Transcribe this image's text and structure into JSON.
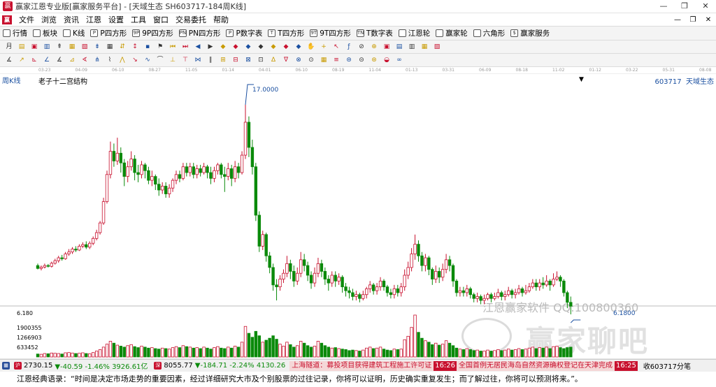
{
  "window": {
    "title": "赢家江恩专业版[赢家服务平台] - [天域生态 SH603717-184周K线]",
    "buttons": [
      "—",
      "❐",
      "✕"
    ]
  },
  "menu": {
    "items": [
      "文件",
      "浏览",
      "资讯",
      "江恩",
      "设置",
      "工具",
      "窗口",
      "交易委托",
      "帮助"
    ],
    "right": [
      "—",
      "❐",
      "✕"
    ]
  },
  "toolbar1": [
    {
      "label": "行情",
      "icon": "grid-icon"
    },
    {
      "label": "板块",
      "icon": "blocks-icon"
    },
    {
      "label": "K线",
      "icon": "candles-icon"
    },
    {
      "label": "P四方形",
      "icon": "P"
    },
    {
      "label": "9P四方形",
      "icon": "9P"
    },
    {
      "label": "PN四方形",
      "icon": "PN"
    },
    {
      "label": "P数字表",
      "icon": "P"
    },
    {
      "label": "T四方形",
      "icon": "T"
    },
    {
      "label": "9T四方形",
      "icon": "9T"
    },
    {
      "label": "T数字表",
      "icon": "TN"
    },
    {
      "label": "江恩轮",
      "icon": "wheel-icon"
    },
    {
      "label": "赢家轮",
      "icon": "wheel-icon"
    },
    {
      "label": "六角形",
      "icon": "hexagon-icon"
    },
    {
      "label": "赢家服务",
      "icon": "$"
    }
  ],
  "toolbar2": [
    "月",
    "▤",
    "▣",
    "▥",
    "⇞",
    "▦",
    "▧",
    "⇟",
    "▦",
    "⇵",
    "↕",
    "▪",
    "⚑",
    "⏮",
    "⏭",
    "◀",
    "▶",
    "◆",
    "◆",
    "◆",
    "◆",
    "◆",
    "◆",
    "◆",
    "✋",
    "+",
    "↖",
    "ƒ",
    "⊘",
    "⊕",
    "▣",
    "▤",
    "▥",
    "▦",
    "▧"
  ],
  "toolbar3": [
    "∡",
    "↗",
    "⊾",
    "∠",
    "∡",
    "⊿",
    "∢",
    "⋔",
    "⌇",
    "⋀",
    "↘",
    "∿",
    "⌒",
    "⊥",
    "⊤",
    "⋈",
    "∥",
    "⊞",
    "⊟",
    "⊠",
    "⊡",
    "∆",
    "∇",
    "⊗",
    "⊙",
    "▦",
    "≡",
    "⊜",
    "⊝",
    "⊛",
    "◒",
    "∞"
  ],
  "ruler": [
    "03-23",
    "04-09",
    "06-10",
    "08-27",
    "11-05",
    "01-14",
    "04-01",
    "06-10",
    "08-19",
    "11-04",
    "01-13",
    "03-31",
    "06-09",
    "08-18",
    "11-02",
    "01-12",
    "03-22",
    "05-31",
    "08-08"
  ],
  "chart_info": {
    "period": "周K线",
    "indicator": "老子十二宫结构",
    "dropdown_glyph": "▼",
    "code": "603717",
    "name": "天域生态"
  },
  "chart_data": {
    "type": "candlestick",
    "ylim": [
      6.18,
      17.0
    ],
    "yticks": [
      "6.180",
      "1900355",
      "1266903",
      "633452"
    ],
    "annotations": {
      "high": "17.0000",
      "low": "6.1800"
    },
    "up_color": "#c8102e",
    "down_color": "#0a8a0a",
    "ohlc": [
      [
        8.7,
        8.55,
        8.8,
        8.5
      ],
      [
        8.55,
        8.62,
        8.7,
        8.45
      ],
      [
        8.62,
        8.7,
        8.8,
        8.55
      ],
      [
        8.7,
        8.66,
        8.78,
        8.6
      ],
      [
        8.66,
        8.82,
        8.9,
        8.6
      ],
      [
        8.82,
        8.95,
        9.05,
        8.75
      ],
      [
        8.95,
        9.1,
        9.2,
        8.85
      ],
      [
        9.1,
        9.05,
        9.25,
        8.95
      ],
      [
        9.05,
        9.3,
        9.4,
        9.0
      ],
      [
        9.3,
        9.4,
        9.55,
        9.2
      ],
      [
        9.4,
        9.55,
        9.65,
        9.3
      ],
      [
        9.55,
        9.5,
        9.7,
        9.4
      ],
      [
        9.5,
        9.7,
        9.8,
        9.45
      ],
      [
        9.7,
        9.78,
        9.9,
        9.6
      ],
      [
        9.78,
        9.65,
        9.95,
        9.55
      ],
      [
        9.65,
        9.85,
        9.95,
        9.55
      ],
      [
        9.85,
        10.1,
        10.2,
        9.75
      ],
      [
        10.1,
        10.4,
        10.55,
        10.0
      ],
      [
        10.4,
        10.9,
        11.0,
        10.3
      ],
      [
        10.9,
        12.0,
        12.2,
        10.8
      ],
      [
        12.0,
        13.4,
        13.6,
        11.9
      ],
      [
        13.4,
        14.6,
        15.1,
        13.2
      ],
      [
        14.6,
        14.1,
        15.0,
        13.8
      ],
      [
        14.1,
        14.5,
        15.3,
        13.9
      ],
      [
        14.5,
        14.0,
        14.8,
        13.5
      ],
      [
        14.0,
        13.3,
        14.2,
        12.8
      ],
      [
        13.3,
        13.8,
        14.1,
        13.0
      ],
      [
        13.8,
        14.2,
        14.6,
        13.6
      ],
      [
        14.2,
        13.5,
        14.4,
        13.1
      ],
      [
        13.5,
        13.4,
        13.9,
        13.0
      ],
      [
        13.4,
        13.9,
        14.1,
        13.2
      ],
      [
        13.9,
        13.6,
        14.0,
        13.2
      ],
      [
        13.6,
        13.1,
        13.8,
        12.9
      ],
      [
        13.1,
        13.3,
        13.6,
        12.8
      ],
      [
        13.3,
        12.9,
        13.4,
        12.6
      ],
      [
        12.9,
        12.6,
        13.2,
        12.3
      ],
      [
        12.6,
        12.8,
        13.0,
        12.4
      ],
      [
        12.8,
        12.4,
        13.0,
        12.2
      ],
      [
        12.4,
        12.7,
        12.9,
        12.2
      ],
      [
        12.7,
        13.1,
        13.2,
        12.5
      ],
      [
        13.1,
        13.4,
        13.6,
        12.9
      ],
      [
        13.4,
        13.2,
        13.6,
        13.0
      ],
      [
        13.2,
        13.8,
        14.0,
        13.1
      ],
      [
        13.8,
        13.5,
        14.0,
        13.3
      ],
      [
        13.5,
        13.8,
        14.0,
        13.3
      ],
      [
        13.8,
        13.4,
        14.0,
        13.2
      ],
      [
        13.4,
        13.7,
        13.9,
        13.2
      ],
      [
        13.7,
        13.5,
        13.9,
        13.3
      ],
      [
        13.5,
        13.8,
        14.0,
        13.4
      ],
      [
        13.8,
        13.5,
        13.9,
        13.2
      ],
      [
        13.5,
        13.2,
        13.8,
        12.9
      ],
      [
        13.2,
        13.6,
        13.8,
        13.0
      ],
      [
        13.6,
        13.9,
        14.0,
        13.4
      ],
      [
        13.9,
        13.4,
        14.0,
        13.2
      ],
      [
        13.4,
        13.3,
        13.8,
        12.5
      ],
      [
        13.3,
        13.7,
        14.0,
        13.1
      ],
      [
        13.7,
        13.2,
        13.9,
        12.8
      ],
      [
        13.2,
        13.8,
        14.1,
        13.0
      ],
      [
        13.8,
        13.5,
        14.0,
        13.2
      ],
      [
        13.5,
        14.4,
        14.6,
        13.4
      ],
      [
        14.4,
        16.1,
        17.0,
        14.2
      ],
      [
        16.1,
        14.8,
        16.4,
        14.3
      ],
      [
        14.8,
        13.8,
        15.2,
        13.4
      ],
      [
        13.8,
        11.3,
        14.0,
        11.0
      ],
      [
        11.3,
        9.7,
        11.5,
        9.4
      ],
      [
        9.7,
        10.3,
        10.5,
        9.5
      ],
      [
        10.3,
        9.2,
        10.4,
        8.9
      ],
      [
        9.2,
        8.6,
        9.4,
        8.3
      ],
      [
        8.6,
        7.7,
        8.8,
        7.4
      ],
      [
        7.7,
        7.6,
        8.0,
        6.9
      ],
      [
        7.6,
        8.0,
        8.2,
        7.4
      ],
      [
        8.0,
        8.3,
        8.5,
        7.8
      ],
      [
        8.3,
        8.8,
        9.2,
        8.1
      ],
      [
        8.8,
        8.4,
        9.0,
        8.0
      ],
      [
        8.4,
        7.9,
        8.7,
        7.6
      ],
      [
        7.9,
        8.3,
        8.6,
        7.7
      ],
      [
        8.3,
        9.0,
        9.4,
        8.1
      ],
      [
        9.0,
        8.7,
        9.3,
        8.4
      ],
      [
        8.7,
        8.2,
        8.9,
        7.9
      ],
      [
        8.2,
        7.8,
        8.4,
        7.5
      ],
      [
        7.8,
        8.3,
        8.6,
        7.6
      ],
      [
        8.3,
        8.8,
        9.1,
        8.1
      ],
      [
        8.8,
        8.4,
        9.0,
        8.1
      ],
      [
        8.4,
        8.0,
        8.6,
        7.7
      ],
      [
        8.0,
        7.8,
        8.2,
        7.4
      ],
      [
        7.8,
        8.2,
        8.4,
        7.6
      ],
      [
        8.2,
        7.9,
        8.4,
        7.6
      ],
      [
        7.9,
        8.1,
        8.3,
        7.7
      ],
      [
        8.1,
        7.6,
        8.2,
        7.3
      ],
      [
        7.6,
        7.4,
        7.8,
        7.1
      ],
      [
        7.4,
        7.3,
        7.6,
        7.0
      ],
      [
        7.3,
        7.1,
        7.5,
        6.9
      ],
      [
        7.1,
        7.2,
        7.4,
        6.9
      ],
      [
        7.2,
        7.0,
        7.3,
        6.8
      ],
      [
        7.0,
        7.2,
        7.4,
        6.9
      ],
      [
        7.2,
        7.5,
        7.6,
        7.0
      ],
      [
        7.5,
        7.7,
        7.9,
        7.3
      ],
      [
        7.7,
        7.4,
        7.8,
        7.2
      ],
      [
        7.4,
        7.6,
        7.8,
        7.2
      ],
      [
        7.6,
        7.9,
        8.1,
        7.4
      ],
      [
        7.9,
        7.6,
        8.0,
        7.4
      ],
      [
        7.6,
        7.3,
        7.7,
        7.1
      ],
      [
        7.3,
        7.2,
        7.5,
        7.0
      ],
      [
        7.2,
        7.5,
        7.7,
        7.0
      ],
      [
        7.5,
        7.3,
        7.7,
        7.1
      ],
      [
        7.3,
        7.6,
        7.8,
        7.1
      ],
      [
        7.6,
        8.2,
        8.5,
        7.4
      ],
      [
        8.2,
        8.6,
        8.9,
        8.0
      ],
      [
        8.6,
        9.3,
        9.6,
        8.4
      ],
      [
        9.3,
        9.8,
        10.3,
        9.0
      ],
      [
        9.8,
        9.2,
        10.0,
        8.9
      ],
      [
        9.2,
        8.7,
        9.4,
        8.4
      ],
      [
        8.7,
        9.1,
        9.3,
        8.4
      ],
      [
        9.1,
        8.5,
        9.2,
        8.2
      ],
      [
        8.5,
        8.0,
        8.6,
        7.7
      ],
      [
        8.0,
        8.4,
        8.7,
        7.8
      ],
      [
        8.4,
        8.1,
        8.6,
        7.8
      ],
      [
        8.1,
        8.5,
        8.8,
        7.9
      ],
      [
        8.5,
        9.0,
        9.3,
        8.3
      ],
      [
        9.0,
        8.7,
        9.2,
        8.4
      ],
      [
        8.7,
        7.9,
        8.8,
        7.6
      ],
      [
        7.9,
        7.3,
        8.0,
        7.1
      ],
      [
        7.3,
        7.4,
        7.6,
        7.1
      ],
      [
        7.4,
        7.3,
        7.6,
        7.1
      ],
      [
        7.3,
        7.5,
        7.7,
        7.1
      ],
      [
        7.5,
        7.2,
        7.6,
        7.0
      ],
      [
        7.2,
        7.0,
        7.3,
        6.8
      ],
      [
        7.0,
        7.1,
        7.3,
        6.8
      ],
      [
        7.1,
        6.9,
        7.2,
        6.7
      ],
      [
        6.9,
        7.0,
        7.2,
        6.7
      ],
      [
        7.0,
        7.2,
        7.3,
        6.9
      ],
      [
        7.2,
        7.0,
        7.3,
        6.8
      ],
      [
        7.0,
        7.1,
        7.3,
        6.9
      ],
      [
        7.1,
        7.3,
        7.5,
        7.0
      ],
      [
        7.3,
        7.1,
        7.4,
        6.9
      ],
      [
        7.1,
        7.2,
        7.4,
        6.9
      ],
      [
        7.2,
        7.4,
        7.6,
        7.1
      ],
      [
        7.4,
        7.2,
        7.5,
        7.0
      ],
      [
        7.2,
        7.3,
        7.5,
        7.0
      ],
      [
        7.3,
        7.5,
        7.7,
        7.2
      ],
      [
        7.5,
        7.3,
        7.6,
        7.1
      ],
      [
        7.3,
        7.4,
        7.7,
        7.2
      ],
      [
        7.4,
        7.6,
        7.8,
        7.3
      ],
      [
        7.6,
        7.8,
        8.0,
        7.5
      ],
      [
        7.8,
        7.6,
        8.0,
        7.4
      ],
      [
        7.6,
        7.8,
        8.0,
        7.4
      ],
      [
        7.8,
        7.7,
        8.1,
        7.5
      ],
      [
        7.7,
        7.9,
        8.2,
        7.6
      ],
      [
        7.9,
        7.7,
        8.0,
        7.4
      ],
      [
        7.7,
        8.0,
        8.3,
        7.6
      ],
      [
        8.0,
        8.1,
        8.4,
        7.9
      ],
      [
        8.1,
        7.9,
        8.2,
        7.6
      ],
      [
        7.9,
        7.3,
        8.0,
        7.1
      ],
      [
        7.3,
        6.8,
        7.4,
        6.5
      ],
      [
        6.8,
        6.6,
        7.1,
        6.18
      ]
    ],
    "volume": [
      60,
      55,
      70,
      65,
      80,
      75,
      70,
      60,
      85,
      90,
      80,
      70,
      75,
      85,
      70,
      65,
      90,
      120,
      150,
      200,
      260,
      320,
      280,
      240,
      220,
      200,
      230,
      250,
      210,
      190,
      220,
      200,
      180,
      190,
      170,
      160,
      180,
      170,
      160,
      190,
      210,
      190,
      230,
      210,
      200,
      180,
      190,
      170,
      200,
      180,
      160,
      190,
      210,
      180,
      170,
      200,
      180,
      220,
      200,
      300,
      620,
      480,
      400,
      520,
      430,
      300,
      340,
      380,
      430,
      360,
      260,
      220,
      300,
      250,
      200,
      230,
      320,
      280,
      230,
      200,
      220,
      320,
      280,
      230,
      200,
      180,
      190,
      170,
      160,
      150,
      130,
      140,
      130,
      120,
      140,
      180,
      200,
      170,
      180,
      200,
      160,
      140,
      130,
      160,
      150,
      160,
      350,
      420,
      600,
      850,
      500,
      380,
      330,
      300,
      250,
      280,
      240,
      260,
      330,
      280,
      230,
      180,
      160,
      150,
      170,
      150,
      130,
      140,
      120,
      120,
      140,
      120,
      130,
      150,
      130,
      140,
      160,
      140,
      150,
      170,
      150,
      160,
      180,
      200,
      170,
      190,
      180,
      200,
      170,
      210,
      220,
      190,
      170,
      190,
      200
    ]
  },
  "ticker": {
    "sh_value": "2730.15",
    "sh_change": "▼-40.59",
    "sh_pct": "-1.46%",
    "sh_amount": "3926.61亿",
    "sz_value": "8055.77",
    "sz_change": "▼-184.71",
    "sz_pct": "-2.24%",
    "sz_amount": "4130.26",
    "news1": "上海隧道：募投项目获得建筑工程施工许可证",
    "time1": "16:26",
    "news2": "全国首例无居民海岛自然资源确权登记在天津完成",
    "time2": "16:25",
    "tail": "收603717分笔"
  },
  "watermark": {
    "brand": "赢家聊吧",
    "tag": "江恩赢家软件 QQ:100800360"
  },
  "quote": "江恩经典语录：“时间是决定市场走势的重要因素，经过详细研究大市及个别股票的过往记录，你将可以证明，历史确实重复发生；而了解过往，你将可以预测将来。”。"
}
